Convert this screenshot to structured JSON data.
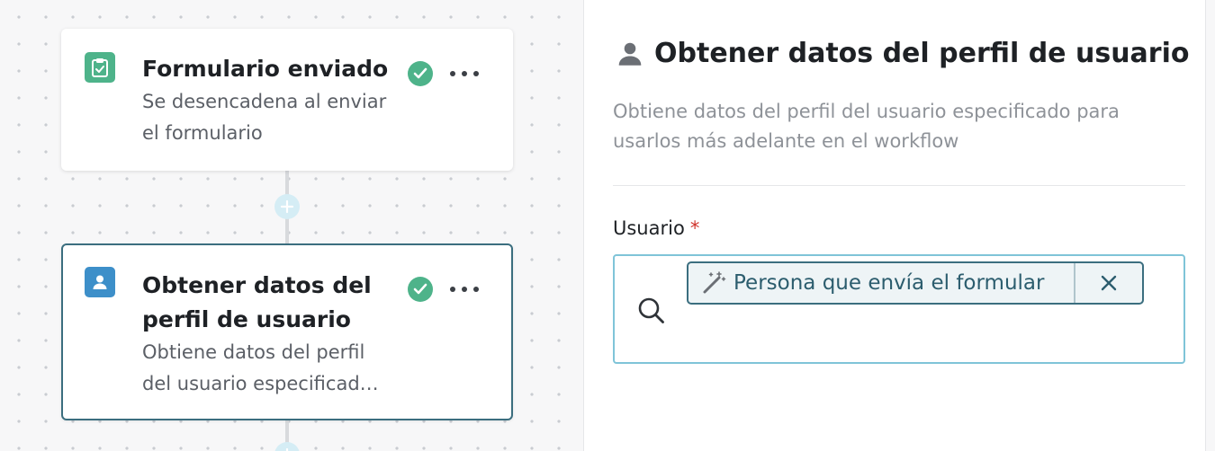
{
  "canvas": {
    "nodes": [
      {
        "title": "Formulario enviado",
        "description_line1": "Se desencadena al enviar",
        "description_line2": "el formulario",
        "icon": "clipboard-check-icon",
        "icon_color": "#4eb38a",
        "status": "check-icon"
      },
      {
        "title_line1": "Obtener datos del",
        "title_line2": "perfil de usuario",
        "description_line1": "Obtiene datos del perfil",
        "description_line2": "del usuario especificad…",
        "icon": "user-icon",
        "icon_color": "#3d8fc9",
        "status": "check-icon",
        "selected": true
      }
    ],
    "add_icon": "plus-icon"
  },
  "panel": {
    "icon": "user-icon",
    "title": "Obtener datos del perfil de usuario",
    "description": "Obtiene datos del perfil del usuario especificado para usarlos más adelante en el workflow",
    "field": {
      "label": "Usuario",
      "required_mark": "*",
      "search_icon": "search-icon",
      "chip": {
        "icon": "magic-wand-icon",
        "label": "Persona que envía el formular",
        "close_icon": "close-icon"
      }
    }
  },
  "colors": {
    "accent": "#3b6e7f",
    "success": "#4eb38a",
    "field_border": "#7fc4d8",
    "required": "#d0342c"
  }
}
